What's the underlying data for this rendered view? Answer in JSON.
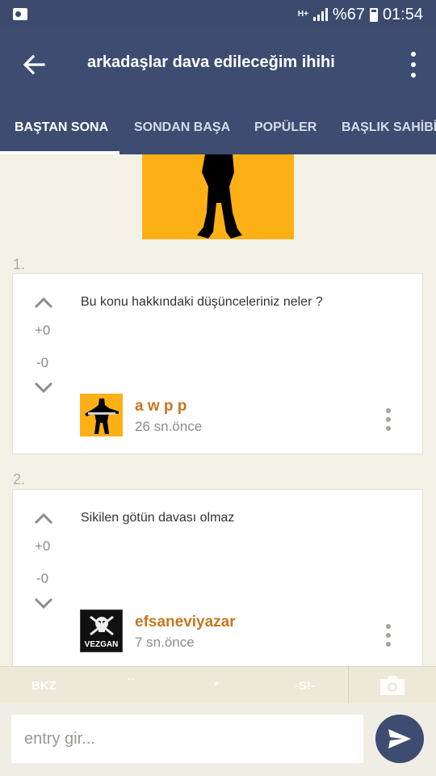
{
  "status_bar": {
    "network": "H+",
    "battery_text": "%67",
    "time": "01:54"
  },
  "app_bar": {
    "title": "arkadaşlar dava edileceğim ihihi",
    "back_icon": "arrow-left-icon",
    "menu_icon": "more-vert-icon"
  },
  "tabs": [
    {
      "label": "BAŞTAN SONA",
      "active": true
    },
    {
      "label": "SONDAN BAŞA",
      "active": false
    },
    {
      "label": "POPÜLER",
      "active": false
    },
    {
      "label": "BAŞLIK SAHİBİ",
      "active": false
    }
  ],
  "entries": [
    {
      "number": "1.",
      "text": "Bu konu hakkındaki düşünceleriniz neler ?",
      "upvotes": "+0",
      "downvotes": "-0",
      "author": "a w p p",
      "time": "26 sn.önce"
    },
    {
      "number": "2.",
      "text": "Sikilen götün davası olmaz",
      "upvotes": "+0",
      "downvotes": "-0",
      "author": "efsaneviyazar",
      "time": "7 sn.önce",
      "avatar_text": "VEZGAN"
    }
  ],
  "format_bar": {
    "buttons": [
      "BKZ",
      "``",
      "*",
      "-S!-"
    ],
    "camera_icon": "camera-icon"
  },
  "composer": {
    "placeholder": "entry gir...",
    "send_icon": "send-icon"
  },
  "colors": {
    "primary": "#3d4c70",
    "author": "#c8761e",
    "avatar_bg": "#fcb016"
  }
}
